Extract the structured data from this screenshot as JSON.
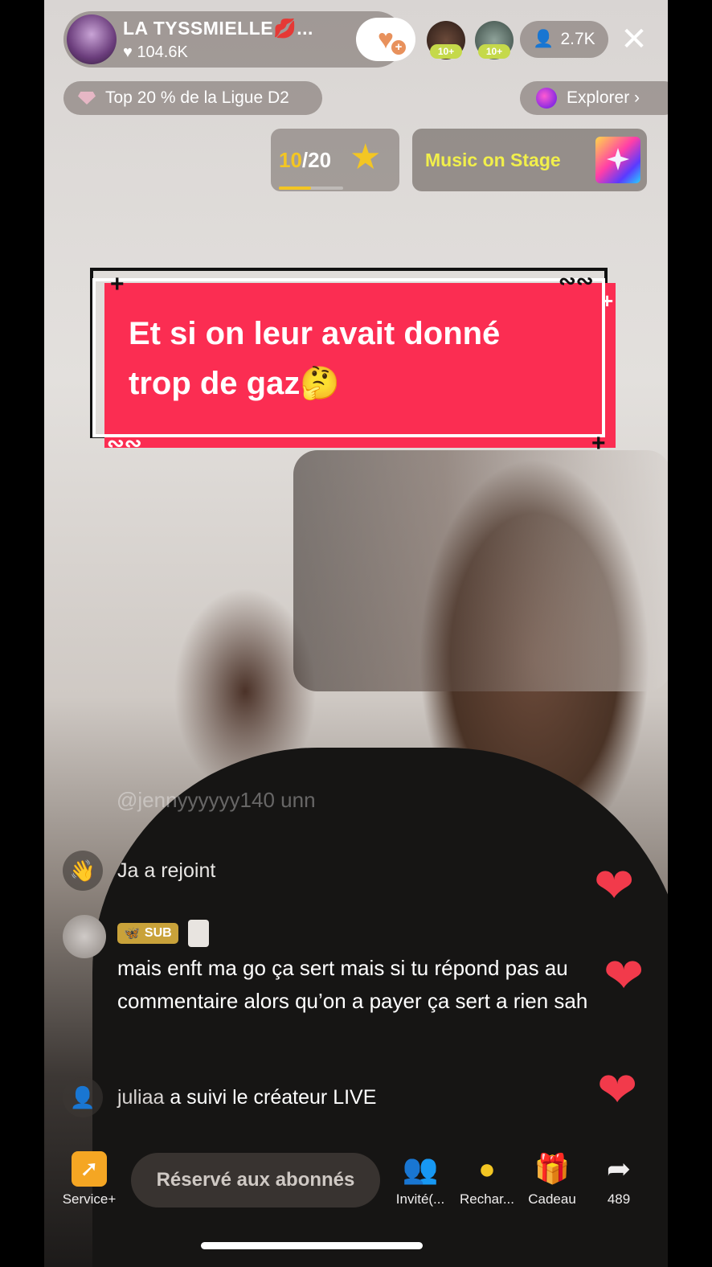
{
  "host": {
    "name": "LA TYSSMIELLE💋...",
    "likes": "104.6K"
  },
  "viewers": {
    "badge_1": "10+",
    "badge_2": "10+",
    "count": "2.7K"
  },
  "league": {
    "label": "Top 20 % de la Ligue D2"
  },
  "explore": {
    "label": "Explorer ›"
  },
  "goal": {
    "current": "10",
    "total": "/20",
    "progress": 0.5
  },
  "music": {
    "label": "Music on Stage"
  },
  "caption": {
    "line1": "Et si on leur avait donné",
    "line2": "trop de gaz🤔"
  },
  "chat": {
    "faded_username": "@jennyyyyyy140 unn",
    "join_text": "Ja a rejoint",
    "message": {
      "badge": "SUB",
      "text": "mais enft ma go ça sert mais si tu répond pas au commentaire alors qu’on a payer ça sert a rien sah"
    },
    "follow": {
      "user": "juliaa",
      "text": " a suivi le créateur LIVE"
    }
  },
  "toolbar": {
    "service": "Service+",
    "input_placeholder": "Réservé aux abonnés",
    "invite": "Invité(...",
    "recharge": "Rechar...",
    "gift": "Cadeau",
    "share_count": "489"
  },
  "colors": {
    "caption_bg": "#fb2d52",
    "goal_accent": "#f3c623",
    "music_text": "#f1ef4b",
    "heart": "#f23a4b"
  }
}
